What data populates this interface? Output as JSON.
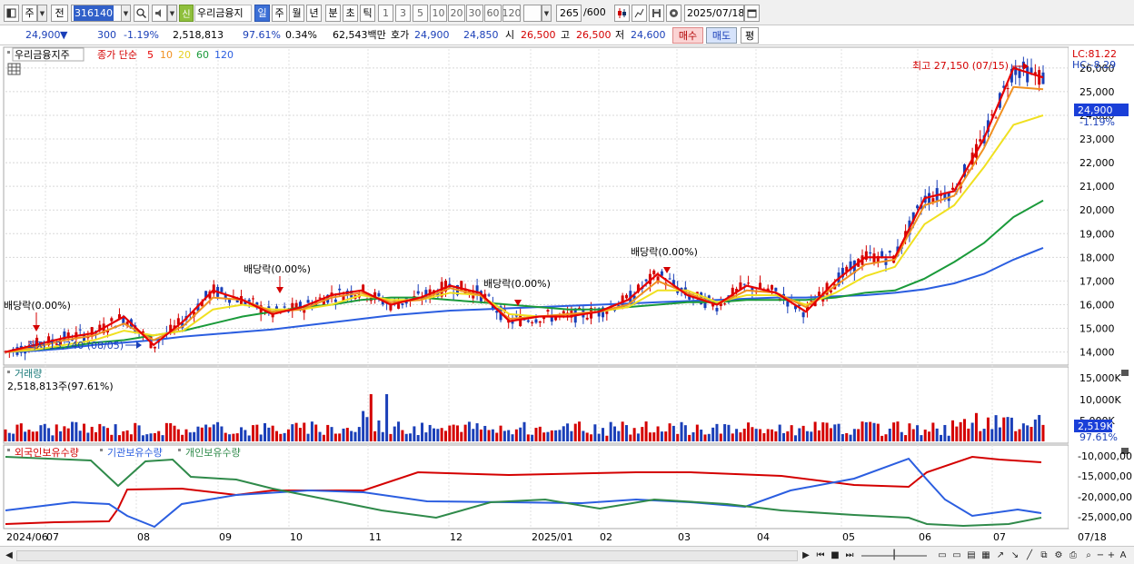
{
  "toolbar": {
    "market": "주",
    "prev": "전",
    "code": "316140",
    "sin": "신",
    "stock_name": "우리금융지",
    "periods": [
      "일",
      "주",
      "월",
      "년",
      "분",
      "초",
      "틱"
    ],
    "intervals": [
      "1",
      "3",
      "5",
      "10",
      "20",
      "30",
      "60",
      "120"
    ],
    "count": "265",
    "count_total": "/600",
    "date": "2025/07/18"
  },
  "quote": {
    "price": "24,900",
    "change_arrow": "▼",
    "change": "300",
    "change_pct": "-1.19%",
    "volume": "2,518,813",
    "vol_ratio": "97.61%",
    "turnover_pct": "0.34%",
    "amount": "62,543백만",
    "hoga_label": "호가",
    "ask": "24,900",
    "bid": "24,850",
    "open_label": "시",
    "open": "26,500",
    "high_label": "고",
    "high": "26,500",
    "low_label": "저",
    "low": "24,600",
    "buy_label": "매수",
    "sell_label": "매도",
    "flat_label": "평"
  },
  "price_panel": {
    "name_label": "우리금융지주",
    "ma_prefix": "종가 단순",
    "ma_periods": [
      "5",
      "10",
      "20",
      "60",
      "120"
    ],
    "ma_colors": [
      "#e60000",
      "#f09020",
      "#f0e020",
      "#1a9a3a",
      "#2b5ee0"
    ],
    "lc_label": "LC:81.22",
    "hc_label": "HC:-8.29",
    "current_badge": "24,900",
    "current_pct": "-1.19%",
    "high_annotation": "최고 27,150 (07/15)",
    "low_annotation": "최저 13,740 (08/05)",
    "dividends": [
      "배당락(0.00%)",
      "배당락(0.00%)",
      "배당락(0.00%)",
      "배당락(0.00%)"
    ]
  },
  "volume_panel": {
    "label": "거래량",
    "value": "2,518,813주(97.61%)",
    "badge": "2,519K",
    "badge_pct": "97.61%",
    "ticks": [
      "15,000K",
      "10,000K",
      "5,000K"
    ]
  },
  "holdings_panel": {
    "series": [
      {
        "name": "외국인보유수량",
        "color": "#d40000"
      },
      {
        "name": "기관보유수량",
        "color": "#2b5ee0"
      },
      {
        "name": "개인보유수량",
        "color": "#2f8a4a"
      }
    ],
    "ticks": [
      "-10,000,00",
      "-15,000,00",
      "-20,000,00",
      "-25,000,00"
    ]
  },
  "x_axis": {
    "labels": [
      "2024/06",
      "07",
      "08",
      "09",
      "10",
      "11",
      "12",
      "2025/01",
      "02",
      "03",
      "04",
      "05",
      "06",
      "07"
    ],
    "end_label": "07/18"
  },
  "chart_data": {
    "type": "line",
    "title": "우리금융지주",
    "y_ticks": [
      14000,
      15000,
      16000,
      17000,
      18000,
      19000,
      20000,
      21000,
      22000,
      23000,
      24000,
      25000,
      26000
    ],
    "ylim": [
      13600,
      26800
    ],
    "months": [
      "2024/06",
      "07",
      "08",
      "09",
      "10",
      "11",
      "12",
      "2025/01",
      "02",
      "03",
      "04",
      "05",
      "06",
      "07"
    ],
    "series": [
      {
        "name": "5",
        "color": "#e60000",
        "values": [
          14000,
          14300,
          14600,
          14800,
          15500,
          14300,
          15300,
          16600,
          16200,
          15600,
          15900,
          16400,
          16600,
          16000,
          16300,
          16800,
          16500,
          15300,
          15500,
          15500,
          15700,
          16200,
          17300,
          16400,
          16000,
          16800,
          16500,
          15700,
          17000,
          18000,
          18000,
          20500,
          20800,
          23000,
          26000,
          25600
        ]
      },
      {
        "name": "10",
        "color": "#f09020",
        "values": [
          14000,
          14200,
          14500,
          14700,
          15200,
          14500,
          15100,
          16300,
          16200,
          15700,
          15800,
          16300,
          16500,
          16100,
          16200,
          16700,
          16400,
          15400,
          15500,
          15600,
          15700,
          16000,
          17000,
          16500,
          16000,
          16600,
          16500,
          15900,
          16800,
          17700,
          17900,
          20200,
          20600,
          22600,
          25200,
          25100
        ]
      },
      {
        "name": "20",
        "color": "#f0e020",
        "values": [
          14000,
          14100,
          14300,
          14500,
          14900,
          14700,
          14900,
          15800,
          16000,
          15800,
          15800,
          16000,
          16400,
          16200,
          16200,
          16500,
          16400,
          15600,
          15500,
          15600,
          15700,
          15900,
          16600,
          16600,
          16100,
          16400,
          16400,
          16000,
          16500,
          17200,
          17600,
          19400,
          20200,
          21800,
          23600,
          24000
        ]
      },
      {
        "name": "60",
        "color": "#1a9a3a",
        "values": [
          14000,
          14100,
          14200,
          14400,
          14500,
          14700,
          14900,
          15200,
          15500,
          15700,
          15900,
          16000,
          16200,
          16300,
          16300,
          16200,
          16100,
          16000,
          15900,
          15800,
          15800,
          15900,
          16000,
          16100,
          16100,
          16200,
          16200,
          16200,
          16300,
          16500,
          16600,
          17100,
          17800,
          18600,
          19700,
          20400
        ]
      },
      {
        "name": "120",
        "color": "#2b5ee0",
        "values": [
          14000,
          14050,
          14150,
          14300,
          14400,
          14500,
          14650,
          14750,
          14850,
          14950,
          15100,
          15250,
          15400,
          15550,
          15650,
          15750,
          15800,
          15850,
          15900,
          15950,
          16000,
          16050,
          16100,
          16150,
          16200,
          16250,
          16300,
          16300,
          16350,
          16400,
          16500,
          16650,
          16900,
          17300,
          17900,
          18400
        ]
      }
    ],
    "annotations": {
      "high": "최고 27,150 (07/15)",
      "low": "최저 13,740 (08/05)"
    }
  }
}
